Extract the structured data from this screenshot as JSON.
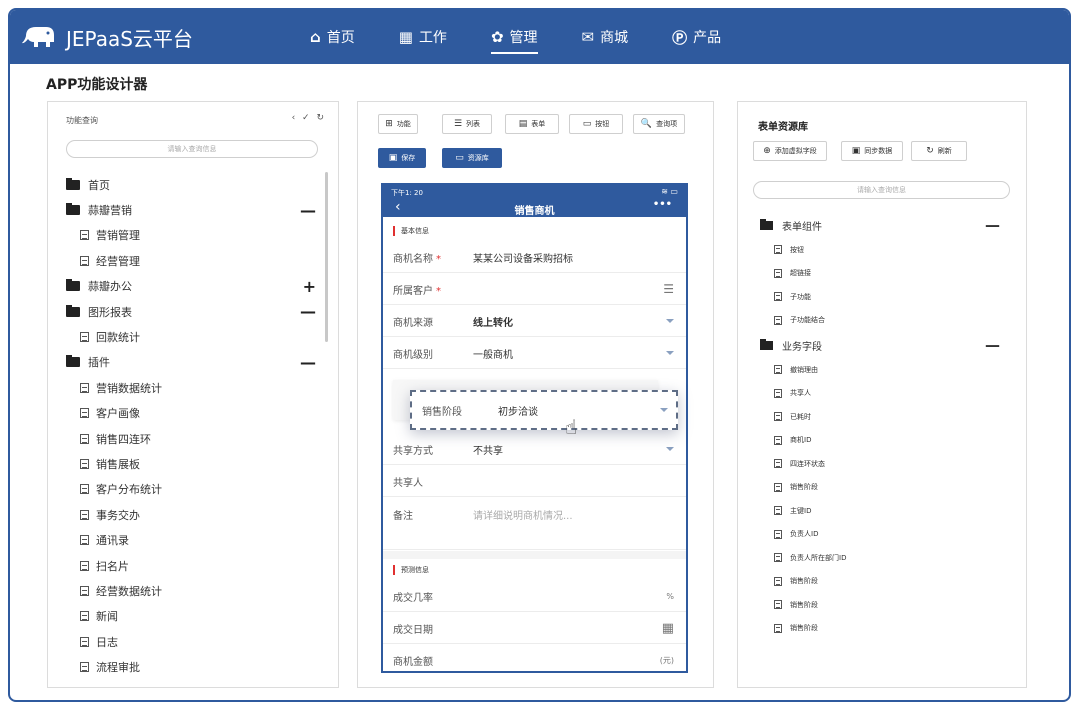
{
  "brand": {
    "name": "JEPaaS云平台"
  },
  "nav": [
    {
      "icon": "⌂",
      "label": "首页"
    },
    {
      "icon": "▦",
      "label": "工作"
    },
    {
      "icon": "✿",
      "label": "管理"
    },
    {
      "icon": "✉",
      "label": "商城"
    },
    {
      "icon": "Ⓟ",
      "label": "产品"
    }
  ],
  "page": {
    "title": "APP功能设计器"
  },
  "left": {
    "head": "功能查询",
    "tools": "‹ ✓ ↻",
    "search_placeholder": "请输入查询信息",
    "tree": [
      {
        "type": "folder",
        "label": "首页",
        "ctl": ""
      },
      {
        "type": "folder",
        "label": "蒜瓣营销",
        "ctl": "—"
      },
      {
        "type": "leaf",
        "label": "营销管理"
      },
      {
        "type": "leaf",
        "label": "经营管理"
      },
      {
        "type": "folder",
        "label": "蒜瓣办公",
        "ctl": "+"
      },
      {
        "type": "folder",
        "label": "图形报表",
        "ctl": "—"
      },
      {
        "type": "leaf",
        "label": "回款统计"
      },
      {
        "type": "folder",
        "label": "插件",
        "ctl": "—"
      },
      {
        "type": "leaf",
        "label": "营销数据统计"
      },
      {
        "type": "leaf",
        "label": "客户画像"
      },
      {
        "type": "leaf",
        "label": "销售四连环"
      },
      {
        "type": "leaf",
        "label": "销售展板"
      },
      {
        "type": "leaf",
        "label": "客户分布统计"
      },
      {
        "type": "leaf",
        "label": "事务交办"
      },
      {
        "type": "leaf",
        "label": "通讯录"
      },
      {
        "type": "leaf",
        "label": "扫名片"
      },
      {
        "type": "leaf",
        "label": "经营数据统计"
      },
      {
        "type": "leaf",
        "label": "新闻"
      },
      {
        "type": "leaf",
        "label": "日志"
      },
      {
        "type": "leaf",
        "label": "流程审批"
      }
    ]
  },
  "mid": {
    "toolbar": [
      {
        "icon": "⊞",
        "label": "功能"
      },
      {
        "icon": "☰",
        "label": "列表"
      },
      {
        "icon": "▤",
        "label": "表单"
      },
      {
        "icon": "▭",
        "label": "按钮"
      },
      {
        "icon": "🔍",
        "label": "查询项"
      }
    ],
    "save_label": "保存",
    "library_label": "资源库",
    "phone": {
      "status_time": "下午1: 20",
      "status_icons": "≋ ▭",
      "back": "‹",
      "title": "销售商机",
      "more": "•••",
      "section1": "基本信息",
      "section2": "预测信息",
      "rows": [
        {
          "label": "商机名称",
          "required": "*",
          "value": "某某公司设备采购招标",
          "right": ""
        },
        {
          "label": "所属客户",
          "required": "*",
          "value": "",
          "right": "☰"
        },
        {
          "label": "商机来源",
          "required": "",
          "value": "线上转化",
          "right": "caret"
        },
        {
          "label": "商机级别",
          "required": "",
          "value": "一般商机",
          "right": "caret"
        },
        {
          "label": "共享方式",
          "required": "",
          "value": "不共享",
          "right": "caret"
        },
        {
          "label": "共享人",
          "required": "",
          "value": "",
          "right": ""
        },
        {
          "label": "备注",
          "required": "",
          "value": "请详细说明商机情况...",
          "right": ""
        }
      ],
      "rows2": [
        {
          "label": "成交几率",
          "value": "",
          "right": "%"
        },
        {
          "label": "成交日期",
          "value": "",
          "right": "▦"
        },
        {
          "label": "商机金额",
          "value": "",
          "right": "(元)"
        }
      ],
      "drag": {
        "label": "销售阶段",
        "value": "初步洽谈"
      }
    }
  },
  "right": {
    "title": "表单资源库",
    "buttons": [
      {
        "icon": "⊕",
        "label": "添加虚拟字段"
      },
      {
        "icon": "▣",
        "label": "同步数据"
      },
      {
        "icon": "↻",
        "label": "刷新"
      }
    ],
    "search_placeholder": "请输入查询信息",
    "tree": [
      {
        "type": "folder",
        "label": "表单组件",
        "ctl": "—"
      },
      {
        "type": "leaf",
        "label": "按钮"
      },
      {
        "type": "leaf",
        "label": "超链接"
      },
      {
        "type": "leaf",
        "label": "子功能"
      },
      {
        "type": "leaf",
        "label": "子功能结合"
      },
      {
        "type": "folder",
        "label": "业务字段",
        "ctl": "—"
      },
      {
        "type": "leaf",
        "label": "撤销理由"
      },
      {
        "type": "leaf",
        "label": "共享人"
      },
      {
        "type": "leaf",
        "label": "已耗时"
      },
      {
        "type": "leaf",
        "label": "商机ID"
      },
      {
        "type": "leaf",
        "label": "四连环状态"
      },
      {
        "type": "leaf",
        "label": "销售阶段"
      },
      {
        "type": "leaf",
        "label": "主键ID"
      },
      {
        "type": "leaf",
        "label": "负责人ID"
      },
      {
        "type": "leaf",
        "label": "负责人所在部门ID"
      },
      {
        "type": "leaf",
        "label": "销售阶段"
      },
      {
        "type": "leaf",
        "label": "销售阶段"
      },
      {
        "type": "leaf",
        "label": "销售阶段"
      }
    ]
  },
  "colors": {
    "primary": "#2f5a9e",
    "required": "#e03030"
  }
}
